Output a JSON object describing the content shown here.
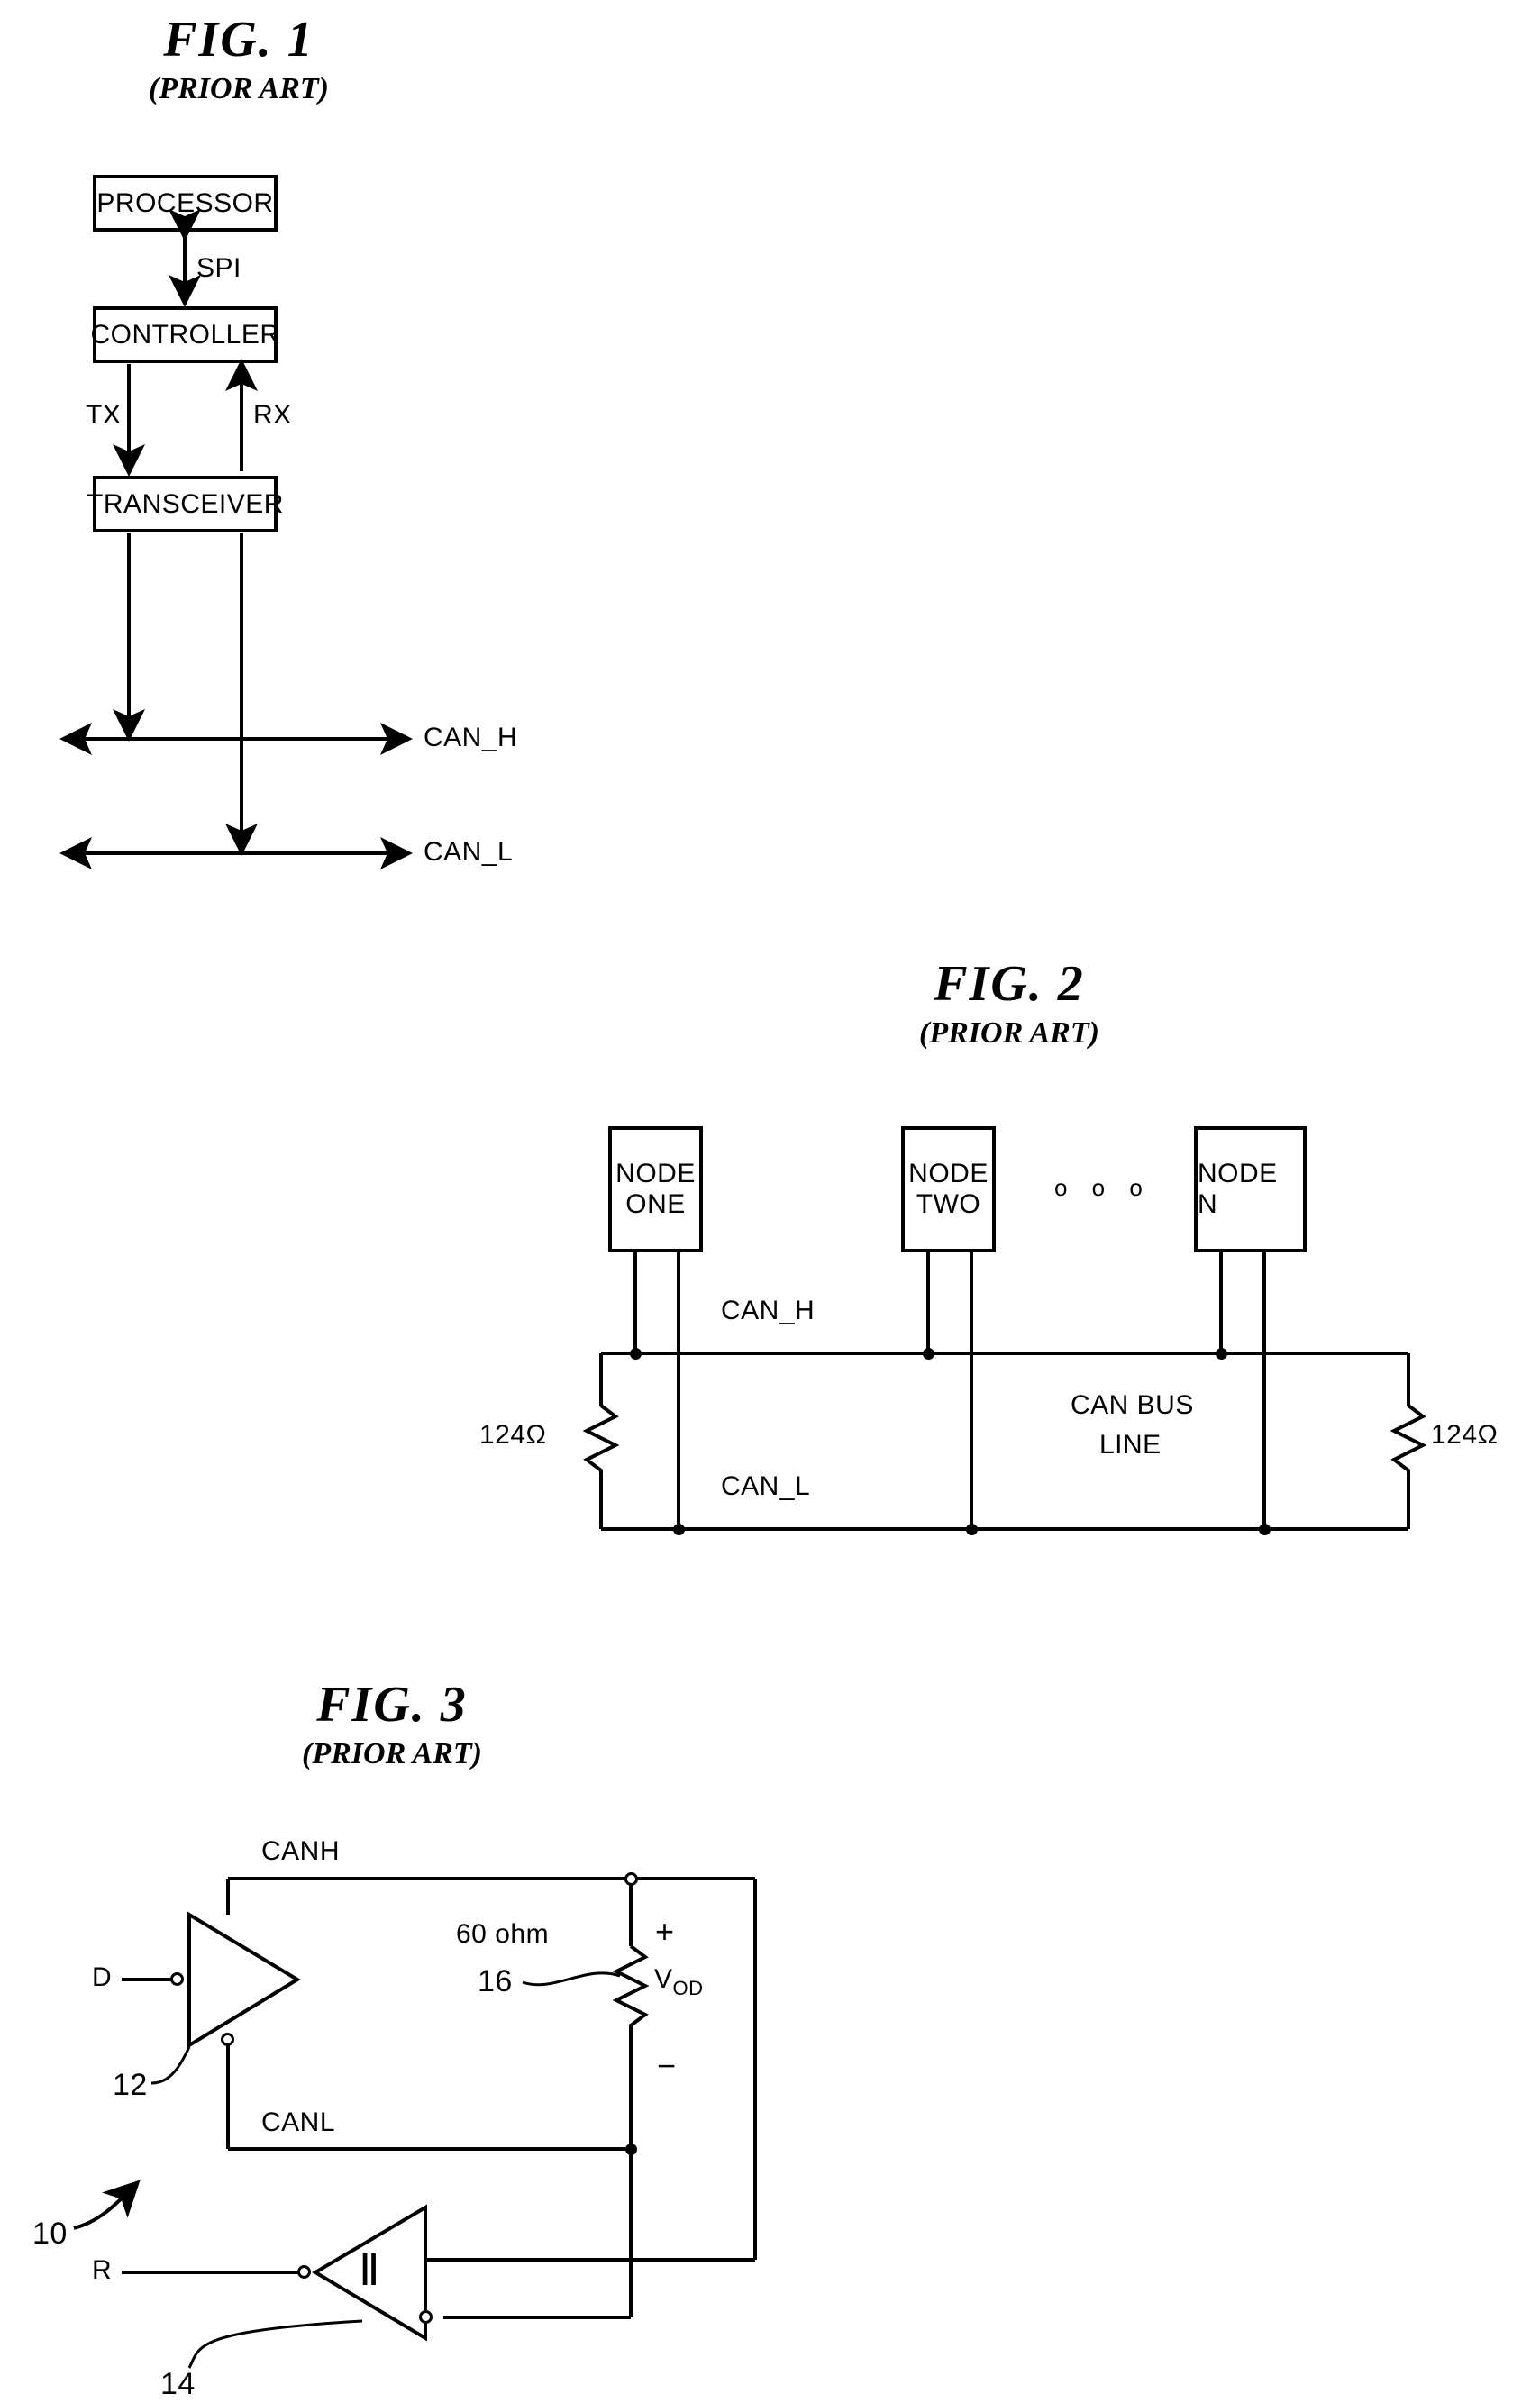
{
  "page": {
    "type": "patent-drawing-sheet",
    "ink_color": "#000000",
    "background": "#ffffff"
  },
  "figures": [
    {
      "id": "fig1",
      "title": "FIG. 1",
      "subtitle": "(PRIOR ART)",
      "blocks": [
        {
          "name": "processor",
          "label": "PROCESSOR"
        },
        {
          "name": "controller",
          "label": "CONTROLLER"
        },
        {
          "name": "transceiver",
          "label": "TRANSCEIVER"
        }
      ],
      "signals": [
        {
          "name": "spi",
          "label": "SPI",
          "direction": "bidirectional"
        },
        {
          "name": "tx",
          "label": "TX",
          "direction": "down"
        },
        {
          "name": "rx",
          "label": "RX",
          "direction": "up"
        }
      ],
      "bus_lines": [
        {
          "name": "can-h",
          "label": "CAN_H"
        },
        {
          "name": "can-l",
          "label": "CAN_L"
        }
      ]
    },
    {
      "id": "fig2",
      "title": "FIG. 2",
      "subtitle": "(PRIOR ART)",
      "nodes": [
        {
          "name": "node-one",
          "line1": "NODE",
          "line2": "ONE"
        },
        {
          "name": "node-two",
          "line1": "NODE",
          "line2": "TWO"
        },
        {
          "name": "node-n",
          "line1": "NODE N",
          "line2": ""
        }
      ],
      "ellipsis": "o o o",
      "bus_labels": {
        "can_h": "CAN_H",
        "can_l": "CAN_L",
        "bus_name_line1": "CAN BUS",
        "bus_name_line2": "LINE"
      },
      "terminators": [
        {
          "name": "left-terminator",
          "value": "124Ω"
        },
        {
          "name": "right-terminator",
          "value": "124Ω"
        }
      ]
    },
    {
      "id": "fig3",
      "title": "FIG. 3",
      "subtitle": "(PRIOR ART)",
      "reference_numerals": [
        {
          "name": "transceiver-ref",
          "value": "10"
        },
        {
          "name": "driver-ref",
          "value": "12"
        },
        {
          "name": "receiver-ref",
          "value": "14"
        },
        {
          "name": "resistor-ref",
          "value": "16"
        }
      ],
      "pins": [
        {
          "name": "driver-input",
          "label": "D"
        },
        {
          "name": "receiver-output",
          "label": "R"
        }
      ],
      "bus_labels": {
        "canh": "CANH",
        "canl": "CANL"
      },
      "resistor": {
        "name": "load-resistor",
        "value": "60 ohm"
      },
      "voltage": {
        "name": "differential-output-voltage",
        "symbol": "V",
        "subscript": "OD",
        "plus": "+",
        "minus": "−"
      },
      "receiver_symbol": "Ⅱ"
    }
  ]
}
